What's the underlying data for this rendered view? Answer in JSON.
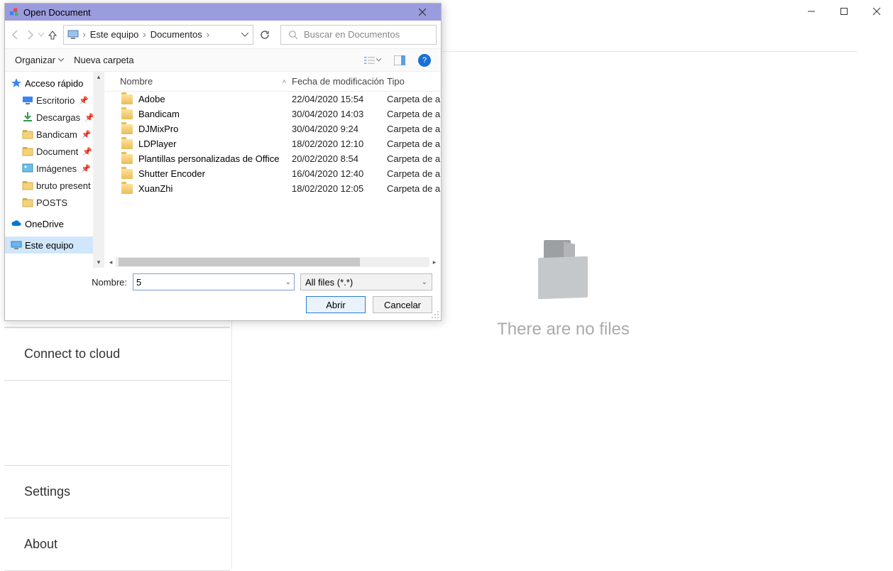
{
  "window": {
    "minimize_tip": "Minimize",
    "maximize_tip": "Maximize",
    "close_tip": "Close"
  },
  "main": {
    "no_files_msg": "There are no files"
  },
  "leftPanel": {
    "connect": "Connect to cloud",
    "settings": "Settings",
    "about": "About"
  },
  "dialog": {
    "title": "Open Document",
    "breadcrumb_root": "Este equipo",
    "breadcrumb_current": "Documentos",
    "search_placeholder": "Buscar en Documentos",
    "organize": "Organizar",
    "new_folder": "Nueva carpeta",
    "columns": {
      "name": "Nombre",
      "date": "Fecha de modificación",
      "type": "Tipo"
    },
    "tree": {
      "quick": "Acceso rápido",
      "onedrive": "OneDrive",
      "thispc": "Este equipo",
      "items": [
        {
          "label": "Escritorio",
          "pin": true
        },
        {
          "label": "Descargas",
          "pin": true
        },
        {
          "label": "Bandicam",
          "pin": true
        },
        {
          "label": "Documentos",
          "pin": true,
          "cut": "Document"
        },
        {
          "label": "Imágenes",
          "pin": true
        },
        {
          "label": "bruto present",
          "pin": false
        },
        {
          "label": "POSTS",
          "pin": false
        }
      ]
    },
    "files": [
      {
        "name": "Adobe",
        "date": "22/04/2020 15:54",
        "type": "Carpeta de a"
      },
      {
        "name": "Bandicam",
        "date": "30/04/2020 14:03",
        "type": "Carpeta de a"
      },
      {
        "name": "DJMixPro",
        "date": "30/04/2020 9:24",
        "type": "Carpeta de a"
      },
      {
        "name": "LDPlayer",
        "date": "18/02/2020 12:10",
        "type": "Carpeta de a"
      },
      {
        "name": "Plantillas personalizadas de Office",
        "date": "20/02/2020 8:54",
        "type": "Carpeta de a"
      },
      {
        "name": "Shutter Encoder",
        "date": "16/04/2020 12:40",
        "type": "Carpeta de a"
      },
      {
        "name": "XuanZhi",
        "date": "18/02/2020 12:05",
        "type": "Carpeta de a"
      }
    ],
    "filename_label": "Nombre:",
    "filename_value": "5",
    "filter_label": "All files (*.*)",
    "open_btn": "Abrir",
    "cancel_btn": "Cancelar"
  }
}
